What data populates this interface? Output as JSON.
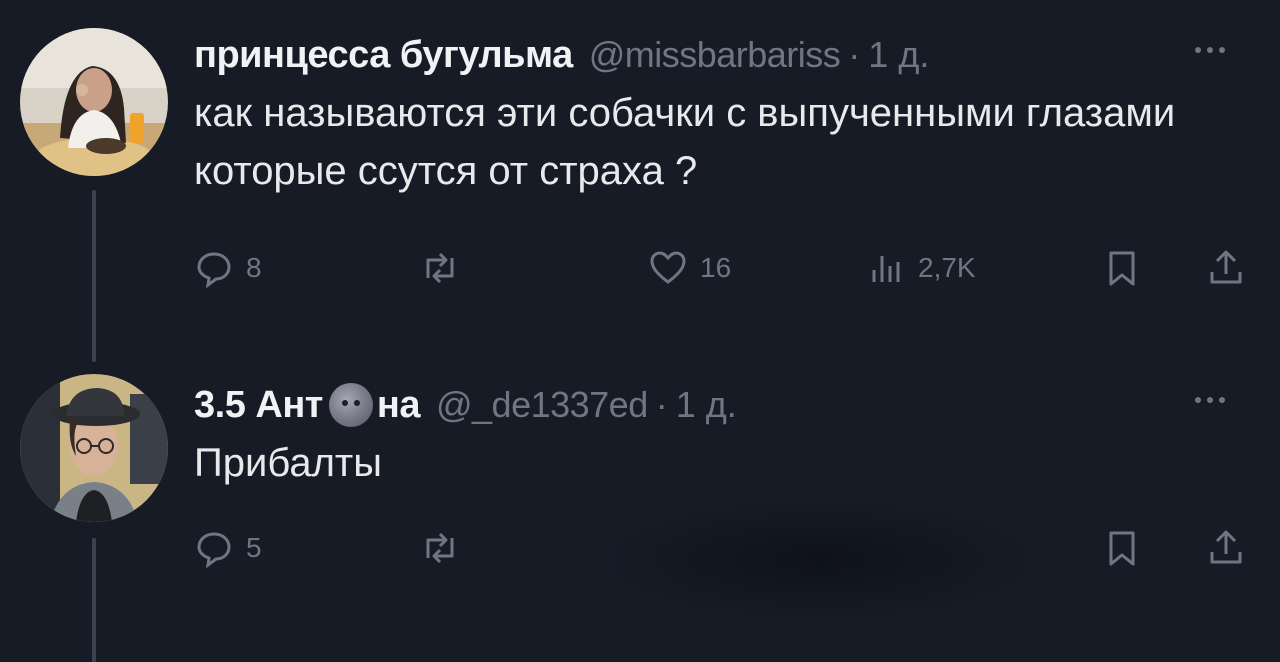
{
  "tweets": [
    {
      "display_name": "принцесса бугульма",
      "handle": "@missbarbariss",
      "separator": "·",
      "time": "1 д.",
      "text": "как называются эти собачки с выпученными глазами которые ссутся от страха ?",
      "replies": "8",
      "likes": "16",
      "views": "2,7K"
    },
    {
      "display_name_before": "3.5 Ант",
      "display_name_emoji": "new-moon-face-emoji",
      "display_name_after": "на",
      "handle": "@_de1337ed",
      "separator": "·",
      "time": "1 д.",
      "text": "Прибалты",
      "replies": "5"
    }
  ],
  "icons": {
    "reply": "reply-icon",
    "retweet": "retweet-icon",
    "like": "heart-icon",
    "views": "views-icon",
    "bookmark": "bookmark-icon",
    "share": "share-icon",
    "more": "more-icon"
  },
  "colors": {
    "background": "#161b26",
    "text": "#e7e9ea",
    "muted": "#6e7781",
    "thread_line": "#3a4250"
  }
}
